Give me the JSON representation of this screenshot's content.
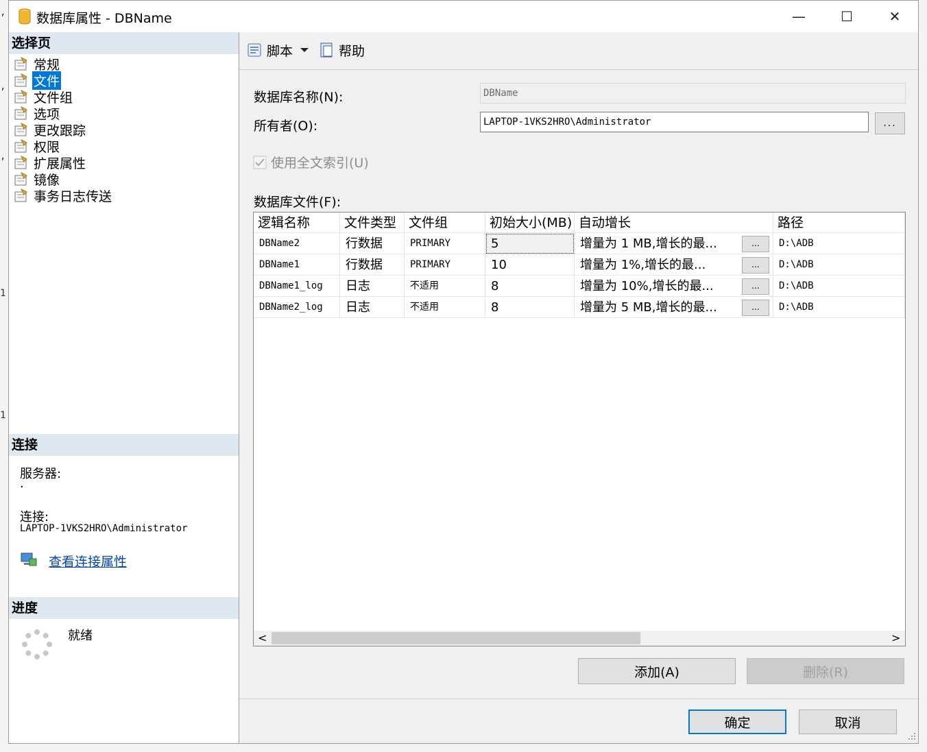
{
  "window": {
    "title": "数据库属性 - DBName",
    "minimize_glyph": "—",
    "maximize_glyph": "☐",
    "close_glyph": "✕"
  },
  "left_panel": {
    "select_page_header": "选择页",
    "pages": [
      {
        "label": "常规",
        "selected": false
      },
      {
        "label": "文件",
        "selected": true
      },
      {
        "label": "文件组",
        "selected": false
      },
      {
        "label": "选项",
        "selected": false
      },
      {
        "label": "更改跟踪",
        "selected": false
      },
      {
        "label": "权限",
        "selected": false
      },
      {
        "label": "扩展属性",
        "selected": false
      },
      {
        "label": "镜像",
        "selected": false
      },
      {
        "label": "事务日志传送",
        "selected": false
      }
    ],
    "connection_header": "连接",
    "server_label": "服务器:",
    "server_value": ".",
    "connection_label": "连接:",
    "connection_value": "LAPTOP-1VKS2HRO\\Administrator",
    "view_connection_link": "查看连接属性",
    "progress_header": "进度",
    "progress_status": "就绪"
  },
  "toolbar": {
    "script_label": "脚本",
    "help_label": "帮助"
  },
  "form": {
    "db_name_label": "数据库名称(N):",
    "db_name_value": "DBName",
    "owner_label": "所有者(O):",
    "owner_value": "LAPTOP-1VKS2HRO\\Administrator",
    "browse_label": "...",
    "fulltext_label": "使用全文索引(U)",
    "fulltext_checked": true,
    "db_files_label": "数据库文件(F):"
  },
  "grid": {
    "columns": [
      "逻辑名称",
      "文件类型",
      "文件组",
      "初始大小(MB)",
      "自动增长",
      "路径"
    ],
    "rows": [
      {
        "name": "DBName2",
        "type": "行数据",
        "filegroup": "PRIMARY",
        "size": "5",
        "growth": "增量为 1 MB,增长的最...",
        "path": "D:\\ADB"
      },
      {
        "name": "DBName1",
        "type": "行数据",
        "filegroup": "PRIMARY",
        "size": "10",
        "growth": "增量为 1%,增长的最...",
        "path": "D:\\ADB"
      },
      {
        "name": "DBName1_log",
        "type": "日志",
        "filegroup": "不适用",
        "size": "8",
        "growth": "增量为 10%,增长的最...",
        "path": "D:\\ADB"
      },
      {
        "name": "DBName2_log",
        "type": "日志",
        "filegroup": "不适用",
        "size": "8",
        "growth": "增量为 5 MB,增长的最...",
        "path": "D:\\ADB"
      }
    ],
    "cell_button_label": "...",
    "scroll_left": "<",
    "scroll_right": ">"
  },
  "buttons": {
    "add": "添加(A)",
    "remove": "删除(R)",
    "ok": "确定",
    "cancel": "取消"
  }
}
